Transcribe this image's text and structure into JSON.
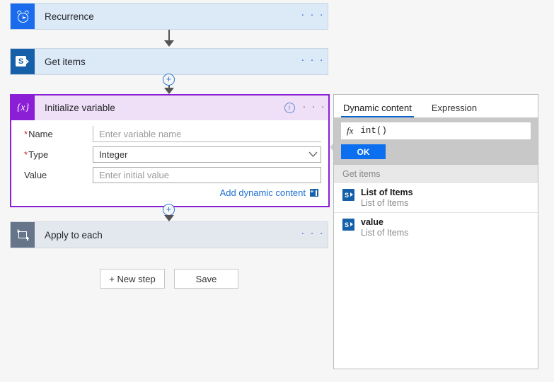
{
  "flow": {
    "steps": [
      {
        "id": "recurrence",
        "title": "Recurrence",
        "icon": "alarm-clock-icon",
        "menu": "· · ·"
      },
      {
        "id": "get-items",
        "title": "Get items",
        "icon": "sharepoint-icon",
        "menu": "· · ·"
      },
      {
        "id": "apply-to-each",
        "title": "Apply to each",
        "icon": "loop-icon",
        "menu": "· · ·"
      }
    ],
    "add_step_symbol": "+"
  },
  "initialize_variable": {
    "title": "Initialize variable",
    "icon_label": "{x}",
    "info_symbol": "i",
    "menu": "· · ·",
    "required_marker": "*",
    "fields": [
      {
        "label": "Name",
        "required": true,
        "value": "",
        "placeholder": "Enter variable name",
        "control": "text"
      },
      {
        "label": "Type",
        "required": true,
        "value": "Integer",
        "placeholder": "",
        "control": "dropdown"
      },
      {
        "label": "Value",
        "required": false,
        "value": "",
        "placeholder": "Enter initial value",
        "control": "text"
      }
    ],
    "add_dynamic_content": "Add dynamic content",
    "chevron_symbol": "⌄"
  },
  "buttons": {
    "new_step": "+ New step",
    "save": "Save"
  },
  "panel": {
    "tabs": [
      {
        "label": "Dynamic content",
        "active": true
      },
      {
        "label": "Expression",
        "active": false
      }
    ],
    "expression": {
      "fx_label": "fx",
      "value": "int()"
    },
    "ok_button": "OK",
    "group_header": "Get items",
    "items": [
      {
        "title": "List of Items",
        "subtitle": "List of Items",
        "icon": "sharepoint-icon"
      },
      {
        "title": "value",
        "subtitle": "List of Items",
        "icon": "sharepoint-icon"
      }
    ]
  },
  "colors": {
    "trigger_blue": "#1b6ced",
    "sharepoint_blue": "#1560a8",
    "variable_purple": "#8A1FD6",
    "variable_purple_light": "#efdff7",
    "card_blue": "#dce9f7",
    "accent_link": "#1d6fd0",
    "ok_blue": "#0b6ff0",
    "required_red": "#c1272d"
  }
}
